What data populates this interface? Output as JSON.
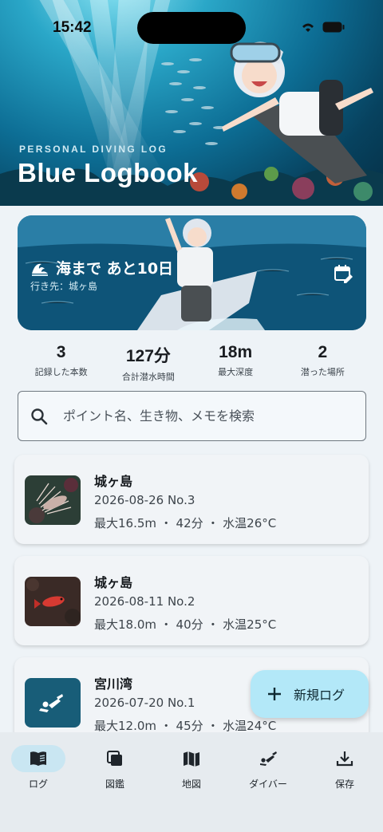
{
  "status": {
    "time": "15:42"
  },
  "hero": {
    "subtitle": "PERSONAL DIVING LOG",
    "title": "Blue Logbook"
  },
  "trip": {
    "title": "海まで あと10日",
    "destination": "行き先：城ヶ島",
    "icon": "wave-icon"
  },
  "stats": [
    {
      "value": "3",
      "label": "記録した本数"
    },
    {
      "value": "127分",
      "label": "合計潜水時間"
    },
    {
      "value": "18m",
      "label": "最大深度"
    },
    {
      "value": "2",
      "label": "潜った場所"
    }
  ],
  "search": {
    "placeholder": "ポイント名、生き物、メモを検索"
  },
  "logs": [
    {
      "name": "城ヶ島",
      "meta": "2026-08-26 No.3",
      "stats": "最大16.5m ・ 42分 ・ 水温26°C",
      "thumb": "lionfish"
    },
    {
      "name": "城ヶ島",
      "meta": "2026-08-11 No.2",
      "stats": "最大18.0m ・ 40分 ・ 水温25°C",
      "thumb": "red-fish"
    },
    {
      "name": "宮川湾",
      "meta": "2026-07-20 No.1",
      "stats": "最大12.0m ・ 45分 ・ 水温24°C",
      "thumb": "diver-icon"
    }
  ],
  "fab": {
    "label": "新規ログ"
  },
  "nav": [
    {
      "label": "ログ",
      "icon": "book-icon",
      "active": true
    },
    {
      "label": "図鑑",
      "icon": "collection-icon",
      "active": false
    },
    {
      "label": "地図",
      "icon": "map-icon",
      "active": false
    },
    {
      "label": "ダイバー",
      "icon": "diver-icon",
      "active": false
    },
    {
      "label": "保存",
      "icon": "download-icon",
      "active": false
    }
  ],
  "colors": {
    "accent": "#b3e8f8",
    "nav_active": "#c9e6f2",
    "diver_tile": "#185d78"
  }
}
